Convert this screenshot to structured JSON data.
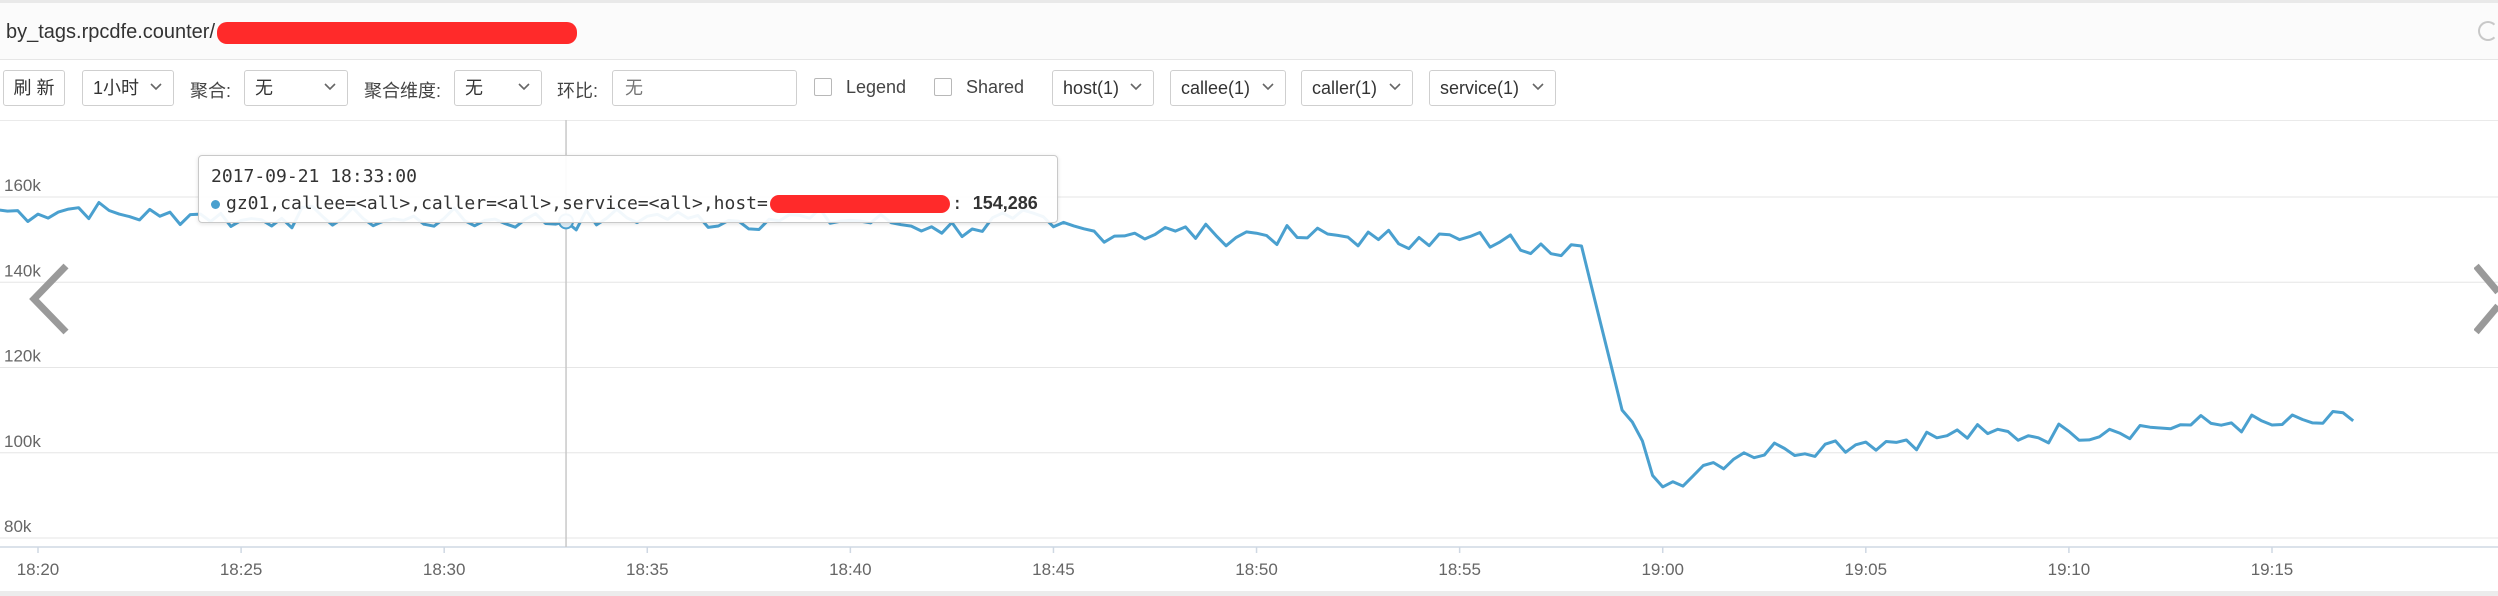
{
  "panel": {
    "title_prefix": "by_tags.rpcdfe.counter/"
  },
  "toolbar": {
    "refresh_label": "刷 新",
    "time_range": "1小时",
    "aggregate_label": "聚合:",
    "aggregate_value": "无",
    "aggregate_dim_label": "聚合维度:",
    "aggregate_dim_value": "无",
    "compare_label": "环比:",
    "compare_placeholder": "无",
    "legend_label": "Legend",
    "shared_label": "Shared",
    "filters": [
      {
        "label": "host(1)"
      },
      {
        "label": "callee(1)"
      },
      {
        "label": "caller(1)"
      },
      {
        "label": "service(1)"
      }
    ]
  },
  "tooltip": {
    "time": "2017-09-21 18:33:00",
    "series_prefix": "gz01,callee=<all>,caller=<all>,service=<all>,host=",
    "series_suffix": ":",
    "value": "154,286"
  },
  "colors": {
    "series": "#4aa0cf",
    "grid": "#e6e6e6",
    "axis_text": "#666666"
  },
  "icons": {
    "prev": "chevron-left-icon",
    "next": "chevron-right-icon",
    "caret": "chevron-down-icon"
  },
  "chart_data": {
    "type": "line",
    "y_ticks": [
      "80k",
      "100k",
      "120k",
      "140k",
      "160k"
    ],
    "ylim": [
      80000,
      170000
    ],
    "x_ticks": [
      "18:20",
      "18:25",
      "18:30",
      "18:35",
      "18:40",
      "18:45",
      "18:50",
      "18:55",
      "19:00",
      "19:05",
      "19:10",
      "19:15"
    ],
    "x_range": [
      "18:19",
      "19:17"
    ],
    "grid": true,
    "hover_x": "18:33",
    "series": [
      {
        "x": [
          "18:19",
          "18:20",
          "18:21",
          "18:22",
          "18:23",
          "18:24",
          "18:25",
          "18:26",
          "18:27",
          "18:28",
          "18:29",
          "18:30",
          "18:31",
          "18:32",
          "18:33",
          "18:34",
          "18:35",
          "18:36",
          "18:37",
          "18:38",
          "18:39",
          "18:40",
          "18:41",
          "18:42",
          "18:43",
          "18:44",
          "18:45",
          "18:46",
          "18:47",
          "18:48",
          "18:49",
          "18:50",
          "18:51",
          "18:52",
          "18:53",
          "18:54",
          "18:55",
          "18:56",
          "18:57",
          "18:58",
          "18:59",
          "19:00",
          "19:01",
          "19:02",
          "19:03",
          "19:04",
          "19:05",
          "19:06",
          "19:07",
          "19:08",
          "19:09",
          "19:10",
          "19:11",
          "19:12",
          "19:13",
          "19:14",
          "19:15",
          "19:16",
          "19:17"
        ],
        "values": [
          157000,
          156000,
          157500,
          156000,
          155500,
          156000,
          154500,
          155000,
          155500,
          155000,
          154500,
          155000,
          154500,
          154800,
          154286,
          155000,
          155500,
          155000,
          154500,
          154800,
          155000,
          154500,
          154000,
          153000,
          152500,
          155000,
          153000,
          152000,
          151500,
          152000,
          151000,
          151500,
          150500,
          151000,
          150000,
          150500,
          150000,
          149500,
          149000,
          148500,
          110000,
          92000,
          97000,
          100000,
          101000,
          102000,
          102500,
          103000,
          104000,
          104500,
          104000,
          105000,
          105500,
          106000,
          106500,
          107000,
          106500,
          107000,
          107500
        ]
      }
    ]
  }
}
